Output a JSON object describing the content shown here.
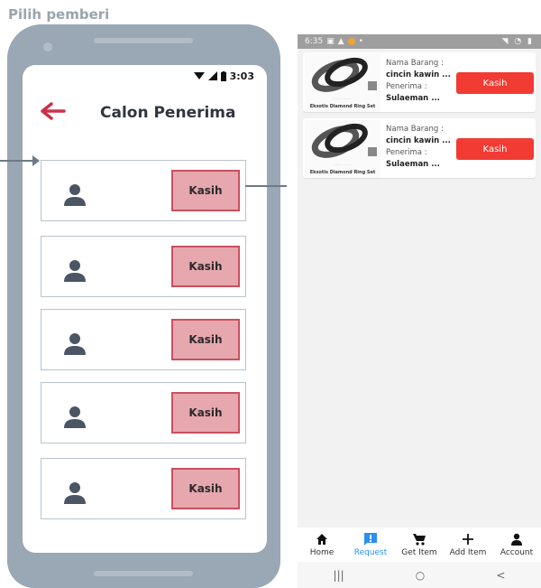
{
  "wireframe": {
    "title": "Pilih pemberi",
    "status_time": "3:03",
    "heading": "Calon Penerima",
    "rows": [
      {
        "button": "Kasih"
      },
      {
        "button": "Kasih"
      },
      {
        "button": "Kasih"
      },
      {
        "button": "Kasih"
      },
      {
        "button": "Kasih"
      }
    ]
  },
  "app": {
    "status_time": "6:35",
    "items": [
      {
        "thumb_caption": "Eksotis Diamond Ring Set",
        "nama_label": "Nama Barang :",
        "nama_value": "cincin kawin ...",
        "penerima_label": "Penerima :",
        "penerima_value": "Sulaeman ...",
        "button": "Kasih"
      },
      {
        "thumb_caption": "Eksotis Diamond Ring Set",
        "nama_label": "Nama Barang :",
        "nama_value": "cincin kawin ...",
        "penerima_label": "Penerima :",
        "penerima_value": "Sulaeman ...",
        "button": "Kasih"
      }
    ],
    "tabs": [
      {
        "label": "Home",
        "icon": "home-icon"
      },
      {
        "label": "Request",
        "icon": "request-icon",
        "active": true
      },
      {
        "label": "Get Item",
        "icon": "cart-icon"
      },
      {
        "label": "Add Item",
        "icon": "plus-icon"
      },
      {
        "label": "Account",
        "icon": "account-icon"
      }
    ],
    "nav": {
      "recent": "|||",
      "home": "○",
      "back": "<"
    }
  },
  "colors": {
    "accent_red": "#f13b33",
    "wire_button": "#e6a7ae",
    "active_tab": "#2a8ff7"
  }
}
